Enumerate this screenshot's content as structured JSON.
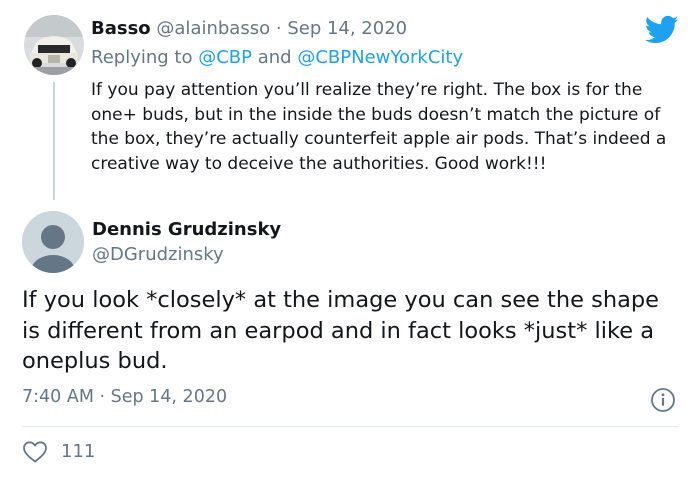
{
  "reply_tweet": {
    "display_name": "Basso",
    "handle": "@alainbasso",
    "separator": "·",
    "date": "Sep 14, 2020",
    "replying_to_prefix": "Replying to",
    "mention_1": "@CBP",
    "and_word": "and",
    "mention_2": "@CBPNewYorkCity",
    "body": "If you pay attention you’ll realize they’re right. The box is for the one+ buds, but in the inside the buds doesn’t match the picture of the box, they’re actually counterfeit apple air pods. That’s indeed a creative way to deceive the authorities. Good work!!!"
  },
  "main_tweet": {
    "display_name": "Dennis Grudzinsky",
    "handle": "@DGrudzinsky",
    "text": "If you look *closely* at the image you can see the shape is different from an earpod and in fact looks *just* like a oneplus bud.",
    "timestamp": "7:40 AM · Sep 14, 2020",
    "likes": "111"
  },
  "colors": {
    "twitter_blue": "#1da1f2",
    "secondary_text": "#657786",
    "heart_red": "#e0245e"
  },
  "icons": [
    "twitter-bird-icon",
    "info-icon",
    "heart-icon"
  ]
}
